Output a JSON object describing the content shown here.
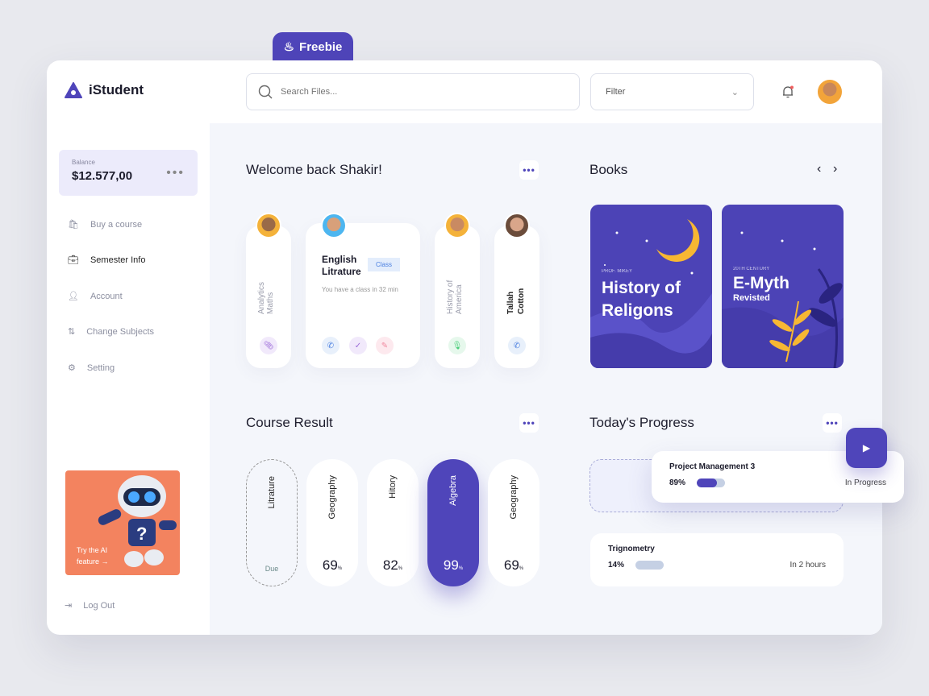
{
  "freebie_tab": {
    "label": "Freebie",
    "icon": "flame-icon"
  },
  "header": {
    "app_name": "iStudent",
    "search_placeholder": "Search Files...",
    "filter_label": "Filter",
    "notification_icon": "bell-icon"
  },
  "sidebar": {
    "balance": {
      "label": "Balance",
      "amount": "$12.577,00"
    },
    "items": [
      {
        "label": "Buy a course",
        "icon": "shopping-bag-icon"
      },
      {
        "label": "Semester Info",
        "icon": "briefcase-icon",
        "active": true
      },
      {
        "label": "Account",
        "icon": "user-icon"
      },
      {
        "label": "Change Subjects",
        "icon": "swap-arrows-icon"
      },
      {
        "label": "Setting",
        "icon": "gear-icon"
      }
    ],
    "ai_promo": {
      "text_line1": "Try the AI",
      "text_line2": "feature"
    },
    "logout": "Log Out"
  },
  "welcome": {
    "title": "Welcome back Shakir!",
    "classes": [
      {
        "subject": "Analytics Maths"
      },
      {
        "subject": "English Litrature",
        "badge": "Class",
        "note": "You have a class in 32 min"
      },
      {
        "subject": "History of America"
      },
      {
        "subject": "Tallah Cotton"
      }
    ]
  },
  "books": {
    "title": "Books",
    "items": [
      {
        "kicker": "PROF. MIKEY",
        "title": "History of Religons"
      },
      {
        "kicker": "20TH CENTURY",
        "title": "E-Myth",
        "subtitle": "Revisted"
      }
    ]
  },
  "course_result": {
    "title": "Course Result",
    "items": [
      {
        "subject": "Litrature",
        "value": "Due"
      },
      {
        "subject": "Geography",
        "value": "69"
      },
      {
        "subject": "Hitory",
        "value": "82"
      },
      {
        "subject": "Algebra",
        "value": "99",
        "highlight": true
      },
      {
        "subject": "Geography",
        "value": "69"
      }
    ],
    "unit": "%"
  },
  "progress": {
    "title": "Today's Progress",
    "items": [
      {
        "name": "Project Management 3",
        "percent": "89%",
        "fill": 89,
        "status": "In Progress"
      },
      {
        "name": "Trignometry",
        "percent": "14%",
        "fill": 14,
        "status": "In 2 hours"
      }
    ]
  },
  "colors": {
    "accent": "#4f45ba",
    "ai_card": "#f3835f",
    "book_bg": "#4c43b6",
    "moon": "#f7b733"
  }
}
